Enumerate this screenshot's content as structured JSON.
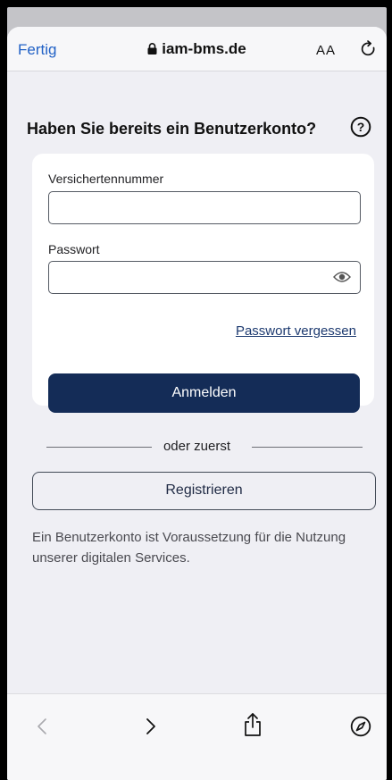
{
  "browser": {
    "done_label": "Fertig",
    "url": "iam-bms.de",
    "text_size_label": "AA"
  },
  "page": {
    "heading": "Haben Sie bereits ein Benutzerkonto?",
    "insurance_number_label": "Versichertennummer",
    "insurance_number_value": "",
    "password_label": "Passwort",
    "password_value": "",
    "forgot_password": "Passwort vergessen",
    "login_button": "Anmelden",
    "divider_text": "oder zuerst",
    "register_button": "Registrieren",
    "hint_text": "Ein Benutzerkonto ist Voraussetzung für die Nutzung unserer digitalen Services."
  },
  "toolbar": {
    "icons": [
      "back-icon",
      "forward-icon",
      "share-icon",
      "compass-icon"
    ]
  },
  "colors": {
    "accent_blue": "#2262c6",
    "primary_button": "#142c57",
    "link": "#1d3a70"
  }
}
